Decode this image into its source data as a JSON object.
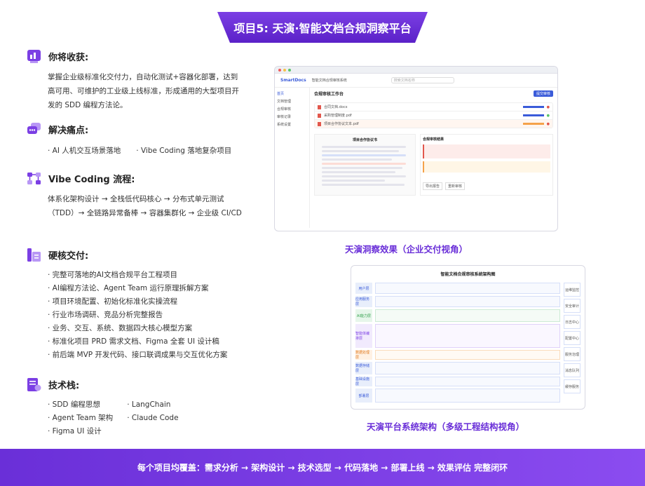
{
  "header": {
    "title": "项目5: 天演·智能文档合规洞察平台"
  },
  "sections": {
    "gain": {
      "title": "你将收获:",
      "text": "掌握企业级标准化交付力，自动化测试+容器化部署，达到高可用、可维护的工业级上线标准，形成通用的大型项目开发的 SDD 编程方法论。"
    },
    "pain": {
      "title": "解决痛点:",
      "items": [
        "· AI 人机交互场景落地",
        "· Vibe Coding 落地复杂项目"
      ]
    },
    "flow": {
      "title": "Vibe Coding 流程:",
      "text": "体系化架构设计 → 全栈低代码核心 → 分布式单元测试（TDD）→ 全链路异常备棒 → 容器集群化 → 企业级 CI/CD"
    },
    "deliver": {
      "title": "硬核交付:",
      "items": [
        "· 完整可落地的AI文档合规平台工程项目",
        "· AI编程方法论、Agent Team 运行原理拆解方案",
        "· 项目环境配置、初始化标准化实操流程",
        "· 行业市场调研、竞品分析完整报告",
        "· 业务、交互、系统、数据四大核心模型方案",
        "· 标准化项目 PRD 需求文档、Figma 全套 UI 设计稿",
        "· 前后端 MVP 开发代码、接口联调成果与交互优化方案"
      ]
    },
    "stack": {
      "title": "技术栈:",
      "col1": [
        "· SDD 编程思想",
        "· Agent Team 架构",
        "· Figma UI 设计"
      ],
      "col2": [
        "· LangChain",
        "· Claude Code"
      ]
    }
  },
  "screenshot1": {
    "brand": "SmartDocs",
    "nav_title": "智能文档合规审核系统",
    "search_placeholder": "搜索文档名称",
    "panel_title": "合规审核工作台",
    "sidebar": [
      "首页",
      "文档管理",
      "合规审核",
      "审核记录",
      "系统设置"
    ],
    "rows": [
      "合同文档.docx",
      "采购管理制度.pdf",
      "项目合作协议文本.pdf"
    ],
    "doc_title": "项目合作协议书",
    "right_title": "合规审核结果",
    "buttons": [
      "导出报告",
      "重新审核",
      "提交审核"
    ]
  },
  "captions": {
    "shot1": "天演洞察效果（企业交付视角）",
    "shot2": "天演平台系统架构（多级工程结构视角）"
  },
  "screenshot2": {
    "title": "智能文档合规审核系统架构图",
    "layers": [
      "用户层",
      "应用服务层",
      "AI能力层",
      "智能体编排层",
      "数据处理层",
      "数据存储层",
      "基础设施层",
      "部署层"
    ],
    "right": [
      "运维监控",
      "安全审计",
      "日志中心",
      "配置中心",
      "服务治理",
      "消息队列",
      "缓存服务"
    ]
  },
  "footer": {
    "text": "每个项目均覆盖：需求分析 → 架构设计 → 技术选型 → 代码落地 → 部署上线 → 效果评估 完整闭环"
  },
  "colors": {
    "accent": "#6a2fd8",
    "accent_light": "#8b4cf0"
  }
}
